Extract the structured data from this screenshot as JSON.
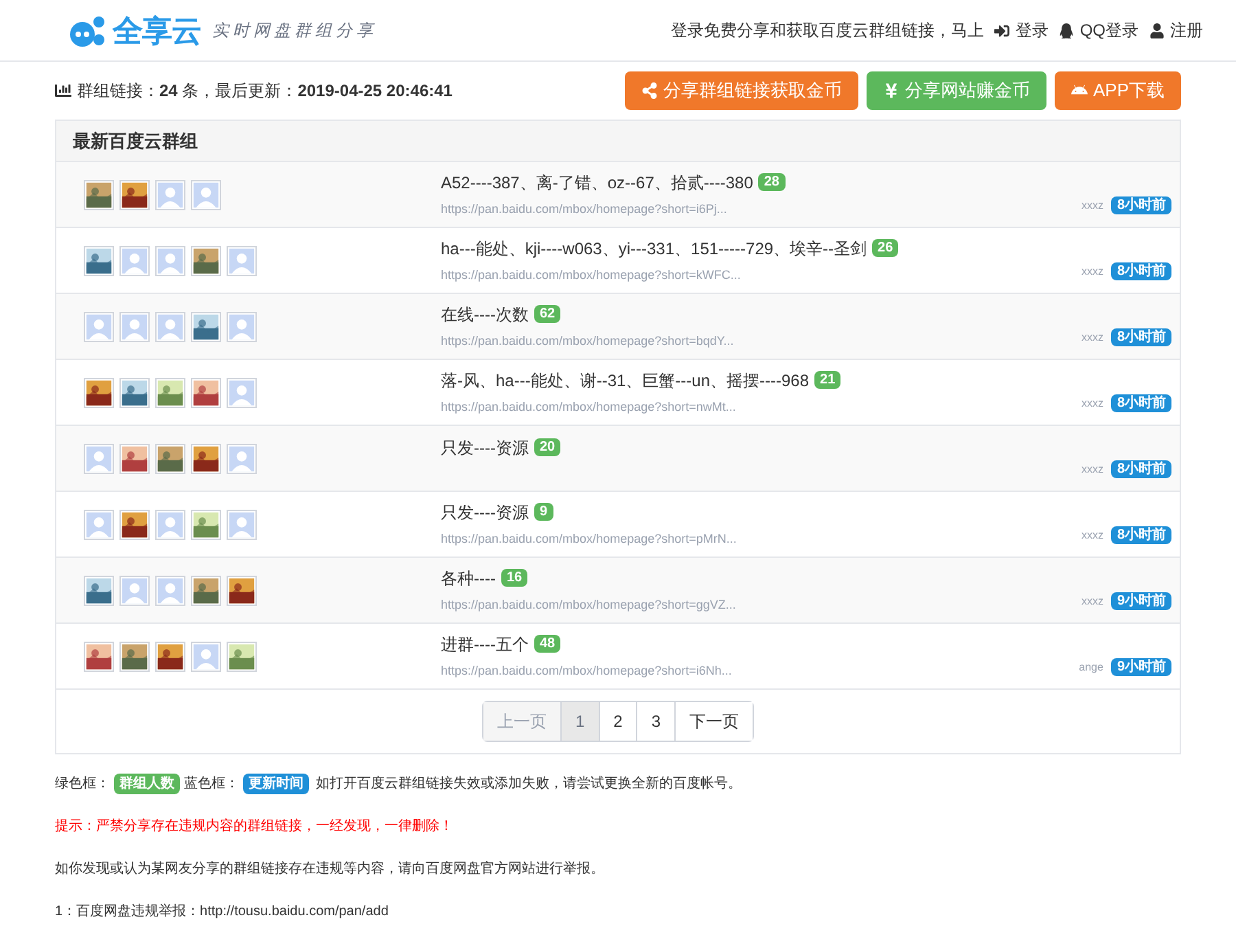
{
  "header": {
    "logo_text": "全享云",
    "tagline": "实时网盘群组分享",
    "prompt": "登录免费分享和获取百度云群组链接，马上",
    "links": [
      {
        "kind": "login",
        "label": "登录"
      },
      {
        "kind": "qq",
        "label": "QQ登录"
      },
      {
        "kind": "user",
        "label": "注册"
      }
    ]
  },
  "stats": {
    "label": "群组链接：",
    "count": "24",
    "unit": "条，最后更新：",
    "updated": "2019-04-25 20:46:41"
  },
  "actions": [
    {
      "kind": "share",
      "label": "分享群组链接获取金币",
      "color": "#f0782a"
    },
    {
      "kind": "yen",
      "label": "分享网站赚金币",
      "color": "#5cb85c"
    },
    {
      "kind": "android",
      "label": "APP下载",
      "color": "#f0782a"
    }
  ],
  "panel": {
    "title": "最新百度云群组",
    "groups": [
      {
        "avatars": [
          {
            "kind": "picture"
          },
          {
            "kind": "picture"
          },
          {
            "kind": "default"
          },
          {
            "kind": "default"
          }
        ],
        "title": "A52----387、离-了错、oz--67、拾贰----380",
        "members": "28",
        "url": "https://pan.baidu.com/mbox/homepage?short=i6Pj...",
        "author": "xxxz",
        "time": "8小时前"
      },
      {
        "avatars": [
          {
            "kind": "picture"
          },
          {
            "kind": "default"
          },
          {
            "kind": "default"
          },
          {
            "kind": "picture"
          },
          {
            "kind": "default"
          }
        ],
        "title": "ha---能处、kji----w063、yi---331、151-----729、埃辛--圣剑",
        "members": "26",
        "url": "https://pan.baidu.com/mbox/homepage?short=kWFC...",
        "author": "xxxz",
        "time": "8小时前"
      },
      {
        "avatars": [
          {
            "kind": "default"
          },
          {
            "kind": "default"
          },
          {
            "kind": "default"
          },
          {
            "kind": "picture"
          },
          {
            "kind": "default"
          }
        ],
        "title": "在线----次数",
        "members": "62",
        "url": "https://pan.baidu.com/mbox/homepage?short=bqdY...",
        "author": "xxxz",
        "time": "8小时前"
      },
      {
        "avatars": [
          {
            "kind": "picture"
          },
          {
            "kind": "picture"
          },
          {
            "kind": "picture"
          },
          {
            "kind": "picture"
          },
          {
            "kind": "default"
          }
        ],
        "title": "落-风、ha---能处、谢--31、巨蟹---un、摇摆----968",
        "members": "21",
        "url": "https://pan.baidu.com/mbox/homepage?short=nwMt...",
        "author": "xxxz",
        "time": "8小时前"
      },
      {
        "avatars": [
          {
            "kind": "default"
          },
          {
            "kind": "picture"
          },
          {
            "kind": "picture"
          },
          {
            "kind": "picture"
          },
          {
            "kind": "default"
          }
        ],
        "title": "只发----资源",
        "members": "20",
        "author": "xxxz",
        "time": "8小时前"
      },
      {
        "avatars": [
          {
            "kind": "default"
          },
          {
            "kind": "picture"
          },
          {
            "kind": "default"
          },
          {
            "kind": "picture"
          },
          {
            "kind": "default"
          }
        ],
        "title": "只发----资源",
        "members": "9",
        "url": "https://pan.baidu.com/mbox/homepage?short=pMrN...",
        "author": "xxxz",
        "time": "8小时前"
      },
      {
        "avatars": [
          {
            "kind": "picture"
          },
          {
            "kind": "default"
          },
          {
            "kind": "default"
          },
          {
            "kind": "picture"
          },
          {
            "kind": "picture"
          }
        ],
        "title": "各种----",
        "members": "16",
        "url": "https://pan.baidu.com/mbox/homepage?short=ggVZ...",
        "author": "xxxz",
        "time": "9小时前"
      },
      {
        "avatars": [
          {
            "kind": "picture"
          },
          {
            "kind": "picture"
          },
          {
            "kind": "picture"
          },
          {
            "kind": "default"
          },
          {
            "kind": "picture"
          }
        ],
        "title": "进群----五个",
        "members": "48",
        "url": "https://pan.baidu.com/mbox/homepage?short=i6Nh...",
        "author": "ange",
        "time": "9小时前"
      }
    ],
    "pagination": [
      {
        "label": "上一页",
        "disabled": true,
        "selected": false
      },
      {
        "label": "1",
        "disabled": false,
        "selected": true
      },
      {
        "label": "2",
        "disabled": false,
        "selected": false
      },
      {
        "label": "3",
        "disabled": false,
        "selected": false
      },
      {
        "label": "下一页",
        "disabled": false,
        "selected": false
      }
    ]
  },
  "legend": {
    "green_label": "绿色框：",
    "green_badge": "群组人数",
    "blue_label": "蓝色框：",
    "blue_badge": "更新时间",
    "note": "如打开百度云群组链接失效或添加失败，请尝试更换全新的百度帐号。"
  },
  "warning": "提示：严禁分享存在违规内容的群组链接，一经发现，一律删除！",
  "report_note": "如你发现或认为某网友分享的群组链接存在违规等内容，请向百度网盘官方网站进行举报。",
  "report_link": "1：百度网盘违规举报：http://tousu.baidu.com/pan/add"
}
